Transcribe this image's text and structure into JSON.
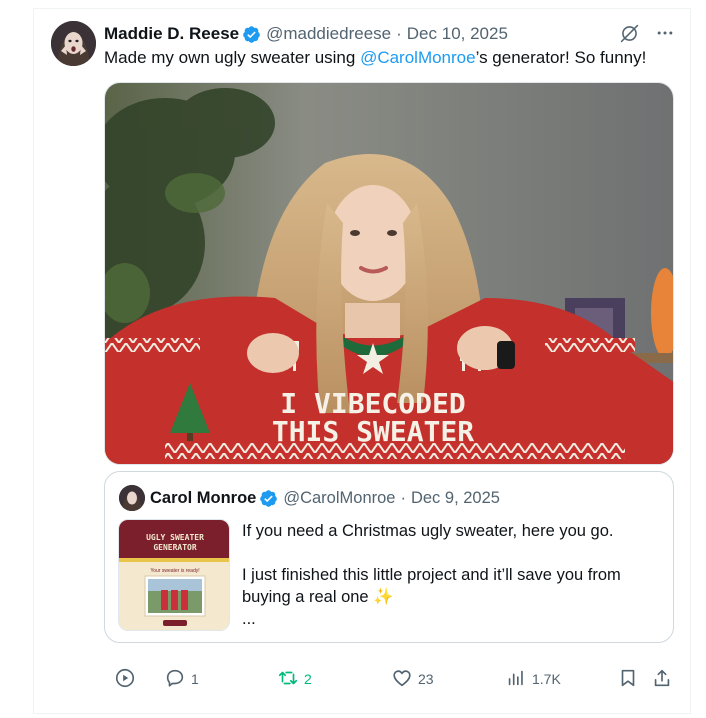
{
  "post": {
    "author_name": "Maddie D. Reese",
    "author_handle": "@maddiedreese",
    "separator": "·",
    "date": "Dec 10, 2025",
    "text_before": "Made my own ugly sweater using ",
    "mention": "@CarolMonroe",
    "text_after": "’s generator! So funny!",
    "image_sweater_text": [
      "I VIBECODED",
      "THIS SWEATER"
    ]
  },
  "quote": {
    "author_name": "Carol Monroe",
    "author_handle": "@CarolMonroe",
    "separator": "·",
    "date": "Dec 9, 2025",
    "line1": "If you need a Christmas ugly sweater, here you go.",
    "line2": "I just finished this little project and it’ll save you from buying a real one ✨",
    "ellipsis": "...",
    "thumb_title": [
      "UGLY SWEATER",
      "GENERATOR"
    ],
    "thumb_caption": "Your sweater is ready!"
  },
  "actions": {
    "replies": "1",
    "reposts": "2",
    "likes": "23",
    "views": "1.7K"
  },
  "colors": {
    "accent": "#1d9bf0",
    "repost": "#00ba7c",
    "muted": "#536471"
  },
  "icons": [
    "verified-badge-icon",
    "grok-icon",
    "more-icon",
    "play-icon",
    "reply-icon",
    "repost-icon",
    "like-icon",
    "views-icon",
    "bookmark-icon",
    "share-icon"
  ]
}
